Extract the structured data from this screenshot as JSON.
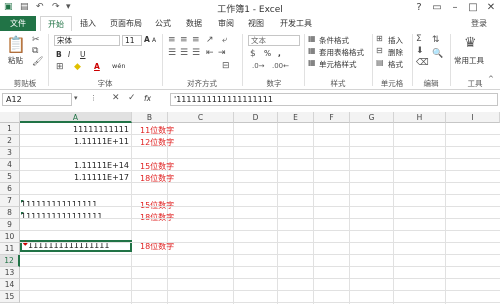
{
  "window": {
    "title": "工作簿1 - Excel",
    "login": "登录"
  },
  "tabs": [
    "文件",
    "开始",
    "插入",
    "页面布局",
    "公式",
    "数据",
    "审阅",
    "视图",
    "开发工具"
  ],
  "ribbon": {
    "clipboard": {
      "paste": "粘贴",
      "label": "剪贴板"
    },
    "font": {
      "name": "宋体",
      "size": "11",
      "bold": "B",
      "italic": "I",
      "underline": "U",
      "grow": "A",
      "shrink": "A",
      "color": "A",
      "wen": "wén",
      "label": "字体"
    },
    "alignment": {
      "label": "对齐方式"
    },
    "number": {
      "format": "文本",
      "percent": "%",
      "comma": ",",
      "label": "数字"
    },
    "styles": {
      "conditional": "条件格式",
      "table": "套用表格格式",
      "cell": "单元格样式",
      "label": "样式"
    },
    "cells": {
      "insert": "插入",
      "delete": "删除",
      "format": "格式",
      "label": "单元格"
    },
    "editing": {
      "label": "编辑"
    },
    "tools": {
      "common": "常用工具",
      "label": "工具"
    }
  },
  "formula_bar": {
    "name_box": "A12",
    "fx": "fx",
    "content": "'1111111111111111111"
  },
  "columns": [
    "A",
    "B",
    "C",
    "D",
    "E",
    "F",
    "G",
    "H",
    "I"
  ],
  "rows": [
    "1",
    "2",
    "3",
    "4",
    "5",
    "6",
    "7",
    "8",
    "9",
    "10",
    "11",
    "12",
    "13",
    "14",
    "15"
  ],
  "cells": {
    "A1": "11111111111",
    "B1": "11位数字",
    "A2": "1.11111E+11",
    "B2": "12位数字",
    "A4": "1.11111E+14",
    "B4": "15位数字",
    "A5": "1.11111E+17",
    "B5": "18位数字",
    "A8": "111111111111111",
    "B8": "15位数字",
    "A9": "1111111111111111",
    "B9": "18位数字",
    "A12": "1111111111111111",
    "B12": "18位数字"
  }
}
